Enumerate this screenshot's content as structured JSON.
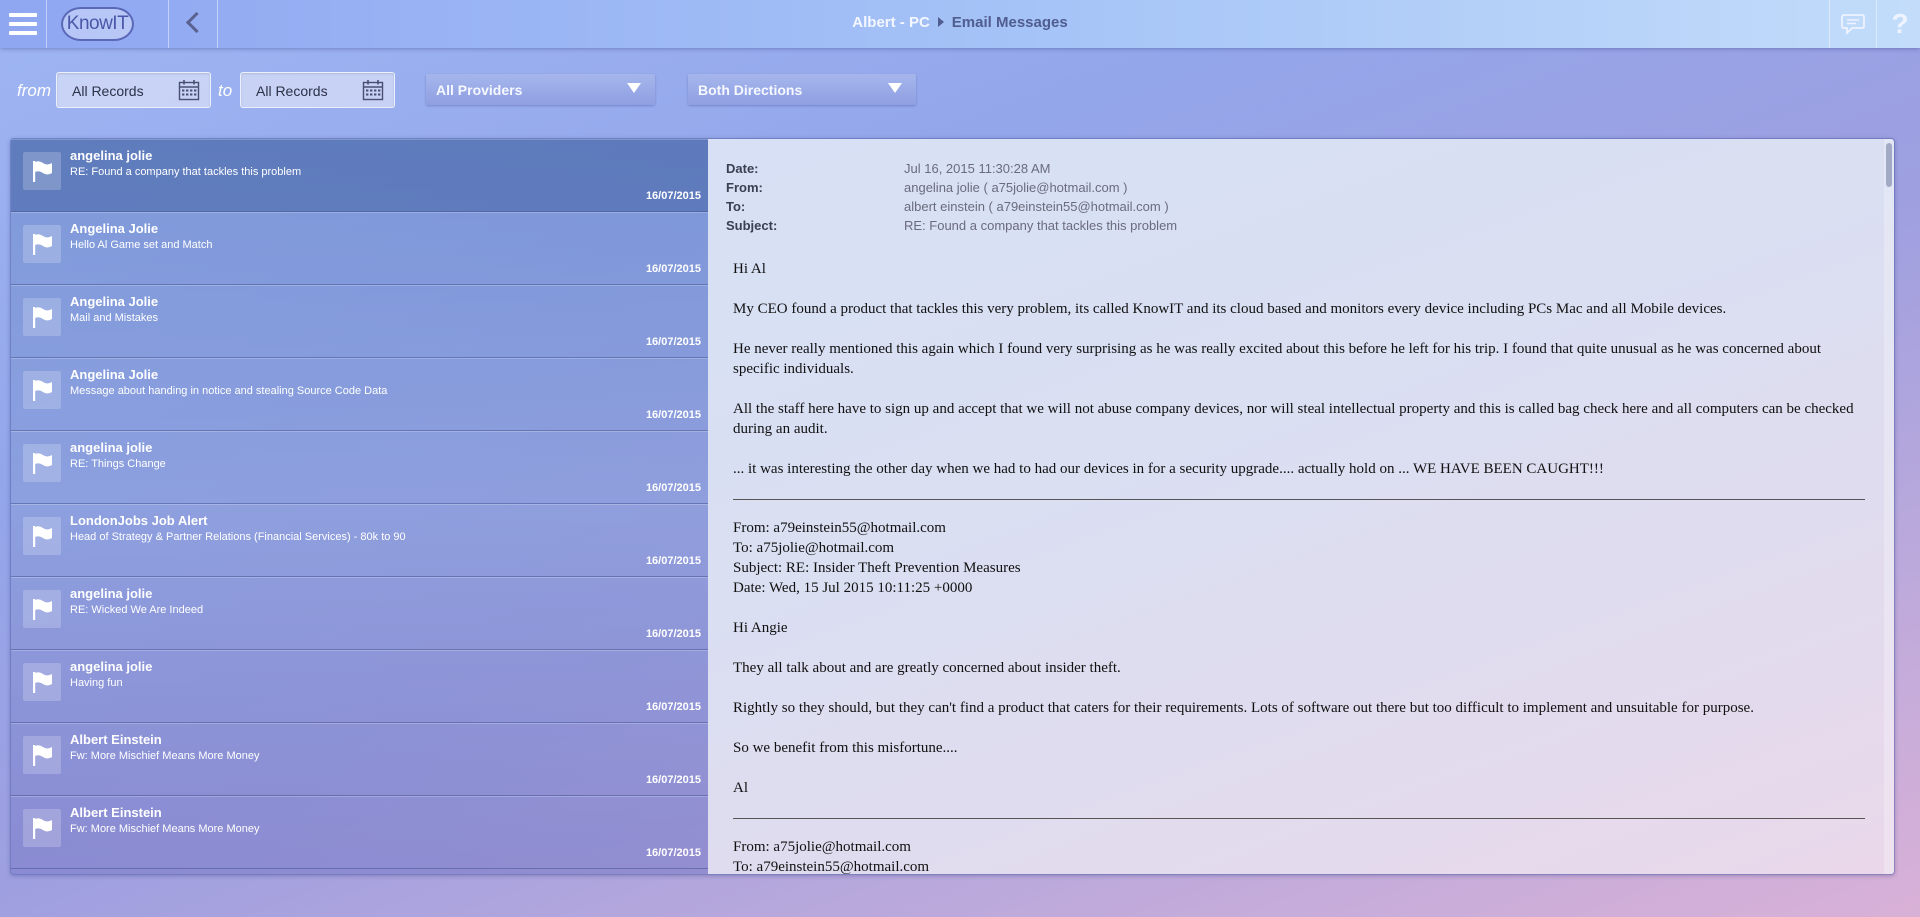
{
  "header": {
    "logo_text": "KnowIT",
    "breadcrumb_root": "Albert - PC",
    "breadcrumb_current": "Email Messages",
    "help_label": "?"
  },
  "filters": {
    "from_label": "from",
    "to_label": "to",
    "from_value": "All Records",
    "to_value": "All Records",
    "provider": "All Providers",
    "direction": "Both Directions"
  },
  "list": {
    "items": [
      {
        "from": "angelina jolie",
        "subject": "RE: Found a company that tackles this problem",
        "date": "16/07/2015",
        "selected": true
      },
      {
        "from": "Angelina Jolie",
        "subject": "Hello Al Game set and Match",
        "date": "16/07/2015"
      },
      {
        "from": "Angelina Jolie",
        "subject": "Mail and Mistakes",
        "date": "16/07/2015"
      },
      {
        "from": "Angelina Jolie",
        "subject": "Message about handing in notice and stealing Source Code Data",
        "date": "16/07/2015"
      },
      {
        "from": "angelina jolie",
        "subject": "RE: Things Change",
        "date": "16/07/2015"
      },
      {
        "from": "LondonJobs Job Alert",
        "subject": "Head of Strategy & Partner Relations (Financial Services) - 80k to 90",
        "date": "16/07/2015"
      },
      {
        "from": "angelina jolie",
        "subject": "RE: Wicked We Are Indeed",
        "date": "16/07/2015"
      },
      {
        "from": "angelina jolie",
        "subject": "Having fun",
        "date": "16/07/2015"
      },
      {
        "from": "Albert Einstein",
        "subject": "Fw: More Mischief Means More Money",
        "date": "16/07/2015"
      },
      {
        "from": "Albert Einstein",
        "subject": "Fw: More Mischief Means More Money",
        "date": "16/07/2015"
      }
    ]
  },
  "detail": {
    "date_label": "Date:",
    "date": "Jul 16, 2015 11:30:28 AM",
    "from_label": "From:",
    "from": "angelina jolie ( a75jolie@hotmail.com )",
    "to_label": "To:",
    "to": "albert einstein ( a79einstein55@hotmail.com )",
    "subject_label": "Subject:",
    "subject": "RE: Found a company that tackles this problem",
    "body": {
      "greeting": "Hi Al",
      "p1": "My CEO found a product that tackles this very problem, its called KnowIT and its cloud based and monitors every device including PCs Mac and all Mobile devices.",
      "p2": "He never really mentioned this again which I found very surprising as he was really excited about this before he left for his trip. I found that quite unusual as he was concerned about specific individuals.",
      "p3": "All the staff here have to sign up and accept that we will not abuse company devices, nor will steal intellectual property and this is called bag check here and all computers can be checked during an audit.",
      "p4": "... it was interesting the other day when we had to had our devices in for a security upgrade.... actually hold on ... WE HAVE BEEN CAUGHT!!!",
      "q1_from": "From: a79einstein55@hotmail.com",
      "q1_to": "To: a75jolie@hotmail.com",
      "q1_subject": "Subject: RE: Insider Theft Prevention Measures",
      "q1_date": "Date: Wed, 15 Jul 2015 10:11:25 +0000",
      "q1_greeting": "Hi Angie",
      "q1_p1": "They all talk about and are greatly concerned about insider theft.",
      "q1_p2": "Rightly so they should, but they can't find a product that caters for their requirements. Lots of software out there but too difficult to implement and unsuitable for purpose.",
      "q1_p3": "So we benefit from this misfortune....",
      "q1_sign": "Al",
      "q2_from": "From: a75jolie@hotmail.com",
      "q2_to": "To: a79einstein55@hotmail.com"
    }
  }
}
